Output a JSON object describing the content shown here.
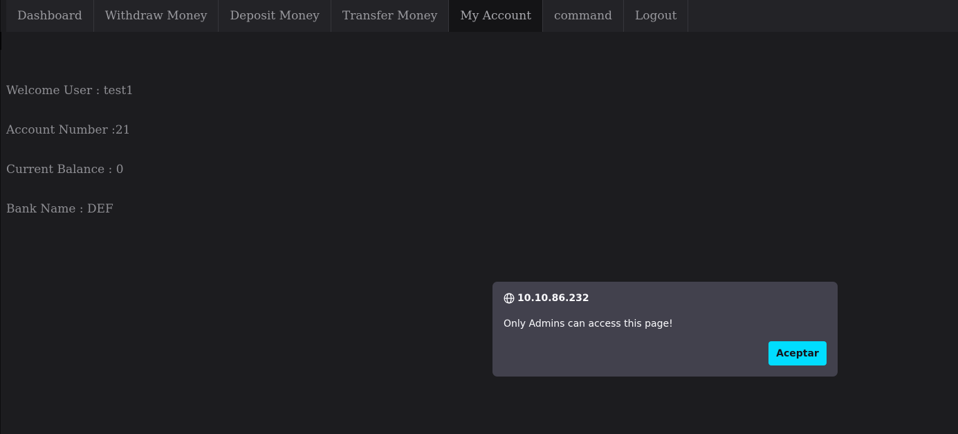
{
  "nav": {
    "items": [
      {
        "label": "Dashboard"
      },
      {
        "label": "Withdraw Money"
      },
      {
        "label": "Deposit Money"
      },
      {
        "label": "Transfer Money"
      },
      {
        "label": "My Account",
        "active": true
      },
      {
        "label": "command"
      },
      {
        "label": "Logout"
      }
    ]
  },
  "account": {
    "welcome": "Welcome User : test1",
    "account_number": "Account Number :21",
    "balance": "Current Balance : 0",
    "bank_name": "Bank Name : DEF"
  },
  "dialog": {
    "origin": "10.10.86.232",
    "message": "Only Admins can access this page!",
    "button_label": "Aceptar",
    "icon": "globe-icon"
  },
  "colors": {
    "background": "#1c1c1f",
    "navbar": "#232327",
    "nav_active": "#141416",
    "dialog_bg": "#42414d",
    "accent": "#00ddff"
  }
}
